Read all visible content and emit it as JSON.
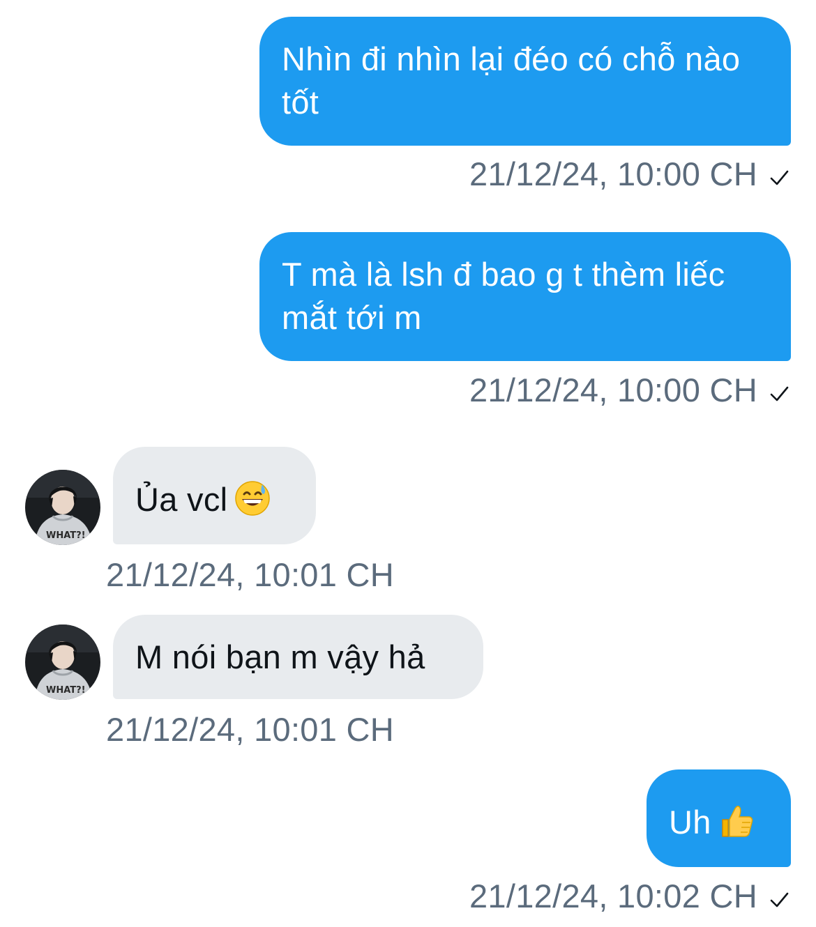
{
  "messages": [
    {
      "text": "Nhìn đi nhìn lại đéo có chỗ nào tốt",
      "time": "21/12/24, 10:00 CH",
      "direction": "outgoing"
    },
    {
      "text": "T mà là lsh đ bao g t thèm liếc mắt tới m",
      "time": "21/12/24, 10:00 CH",
      "direction": "outgoing"
    },
    {
      "text": "Ủa vcl",
      "emoji": "grinning-face-with-sweat",
      "time": "21/12/24, 10:01 CH",
      "direction": "incoming"
    },
    {
      "text": "M nói bạn m vậy hả",
      "time": "21/12/24, 10:01 CH",
      "direction": "incoming"
    },
    {
      "text": "Uh",
      "emoji": "thumbs-up",
      "time": "21/12/24, 10:02 CH",
      "direction": "outgoing"
    }
  ],
  "colors": {
    "outgoing_bubble": "#1d9bf0",
    "incoming_bubble": "#e8ebee",
    "timestamp": "#5b6b7c"
  },
  "icons": {
    "read_receipt": "check-icon",
    "avatar": "user-avatar"
  }
}
